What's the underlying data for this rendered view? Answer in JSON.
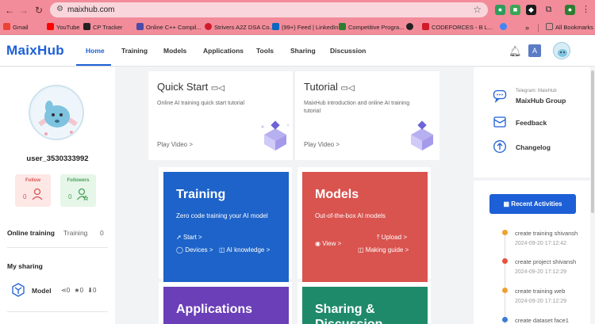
{
  "browser": {
    "url": "maixhub.com",
    "bookmarks": [
      {
        "label": "Gmail",
        "color": "#ea4335"
      },
      {
        "label": "YouTube",
        "color": "#ff0000"
      },
      {
        "label": "CP Tracker",
        "color": "#222222"
      },
      {
        "label": "Online C++ Compil...",
        "color": "#4a4aa8"
      },
      {
        "label": "Strivers A2Z DSA Co...",
        "color": "#d11a2a"
      },
      {
        "label": "(99+) Feed | LinkedIn",
        "color": "#0a66c2"
      },
      {
        "label": "Competitive Progra...",
        "color": "#2e7d32"
      },
      {
        "label": "",
        "color": "#222222"
      },
      {
        "label": "CODEFORCES - B L...",
        "color": "#d11a2a"
      },
      {
        "label": "",
        "color": "#4285f4"
      }
    ],
    "all_bookmarks": "All Bookmarks"
  },
  "header": {
    "logo": "MaixHub",
    "nav": [
      "Home",
      "Training",
      "Models",
      "Applications",
      "Tools",
      "Sharing",
      "Discussion"
    ],
    "active_nav": "Home"
  },
  "profile": {
    "username": "user_3530333992",
    "follow_label": "Follow",
    "follow_count": "0",
    "followers_label": "Followers",
    "followers_count": "0",
    "online_training": "Online training",
    "training_label": "Training",
    "training_count": "0",
    "my_sharing": "My sharing",
    "model_label": "Model",
    "model_shares": "0",
    "model_stars": "0",
    "model_downloads": "0"
  },
  "quick_cards": [
    {
      "title": "Quick Start",
      "desc": "Online AI training quick start tutorial",
      "link": "Play Video >"
    },
    {
      "title": "Tutorial",
      "desc": "MaixHub introduction and online AI training tutorial",
      "link": "Play Video >"
    }
  ],
  "features": {
    "training": {
      "title": "Training",
      "desc": "Zero code training your AI model",
      "start": "Start >",
      "devices": "Devices >",
      "ai_knowledge": "AI knowledge >",
      "color": "#1d63c9"
    },
    "models": {
      "title": "Models",
      "desc": "Out-of-the-box AI models",
      "view": "View >",
      "upload": "Upload >",
      "guide": "Making guide >",
      "color": "#d9534f"
    },
    "applications": {
      "title": "Applications",
      "color": "#6a3fb8"
    },
    "sharing": {
      "title": "Sharing &",
      "title2": "Discussion",
      "color": "#1f8a6a"
    }
  },
  "right": {
    "telegram_small": "Telegram: MaixHub",
    "group": "MaixHub Group",
    "feedback": "Feedback",
    "changelog": "Changelog",
    "recent_button": "Recent Activities",
    "activities": [
      {
        "text": "create training shivansh",
        "time": "2024-09-20 17:12:42",
        "color": "#f0a030"
      },
      {
        "text": "create project shivansh",
        "time": "2024-09-20 17:12:29",
        "color": "#e5533d"
      },
      {
        "text": "create training web",
        "time": "2024-09-20 17:12:29",
        "color": "#f0a030"
      },
      {
        "text": "create dataset face1",
        "time": "",
        "color": "#3a7bd5"
      }
    ]
  }
}
